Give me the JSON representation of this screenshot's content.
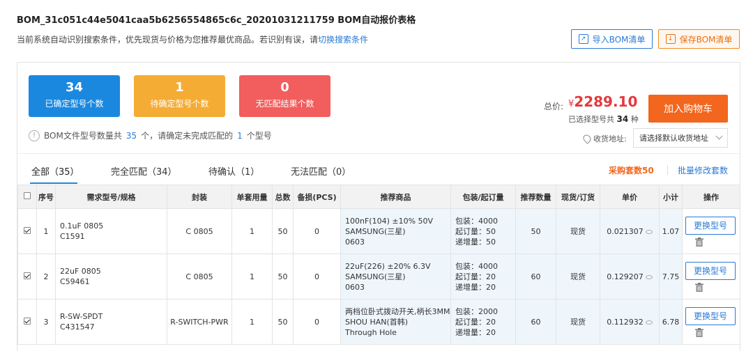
{
  "header": {
    "title": "BOM_31c051c44e5041caa5b6256554865c6c_20201031211759 BOM自动报价表格",
    "hint_text": "当前系统自动识别搜索条件，优先现货与价格为您推荐最优商品。若识别有误，请",
    "hint_link": "切换搜索条件",
    "import_button": "导入BOM清单",
    "save_button": "保存BOM清单"
  },
  "stats": [
    {
      "num": "34",
      "label": "已确定型号个数",
      "color": "#1b88df"
    },
    {
      "num": "1",
      "label": "待确定型号个数",
      "color": "#f5ac34"
    },
    {
      "num": "0",
      "label": "无匹配结果个数",
      "color": "#f25d5d"
    }
  ],
  "notice": {
    "prefix": "BOM文件型号数量共",
    "total": "35",
    "middle": "个，请确定未完成匹配的",
    "pending": "1",
    "suffix": "个型号"
  },
  "summary": {
    "total_label": "总价:",
    "currency": "¥",
    "total_value": "2289.10",
    "selected_prefix": "已选择型号共",
    "selected_count": "34",
    "selected_suffix": "种",
    "cart_button": "加入购物车",
    "address_label": "收货地址:",
    "address_placeholder": "请选择默认收货地址"
  },
  "tabs": [
    {
      "label": "全部（35）"
    },
    {
      "label": "完全匹配（34）"
    },
    {
      "label": "待确认（1）"
    },
    {
      "label": "无法匹配（0）"
    }
  ],
  "actions": {
    "purchase_sets": "采购套数50",
    "batch_edit": "批量修改套数"
  },
  "table": {
    "headers": [
      "序号",
      "需求型号/规格",
      "封装",
      "单套用量",
      "总数",
      "备损(PCS)",
      "推荐商品",
      "包装/起订量",
      "推荐数量",
      "现货/订货",
      "单价",
      "小计",
      "操作"
    ],
    "replace_label": "更换型号",
    "rows": [
      {
        "no": "1",
        "req1": "0.1uF 0805",
        "req2": "C1591",
        "package": "C 0805",
        "qty": "1",
        "total": "50",
        "loss": "0",
        "rec1": "100nF(104) ±10% 50V",
        "rec2": "SAMSUNG(三星)",
        "rec3": "0603",
        "pack1": "包装：4000",
        "pack2": "起订量：50",
        "pack3": "递增量：50",
        "rec_qty": "50",
        "stock": "现货",
        "price": "0.021307",
        "subtotal": "1.07"
      },
      {
        "no": "2",
        "req1": "22uF 0805",
        "req2": "C59461",
        "package": "C 0805",
        "qty": "1",
        "total": "50",
        "loss": "0",
        "rec1": "22uF(226) ±20% 6.3V",
        "rec2": "SAMSUNG(三星)",
        "rec3": "0603",
        "pack1": "包装：4000",
        "pack2": "起订量：20",
        "pack3": "递增量：20",
        "rec_qty": "60",
        "stock": "现货",
        "price": "0.129207",
        "subtotal": "7.75"
      },
      {
        "no": "3",
        "req1": "R-SW-SPDT",
        "req2": "C431547",
        "package": "R-SWITCH-PWR",
        "qty": "1",
        "total": "50",
        "loss": "0",
        "rec1": "两档位卧式拨动开关,柄长3MM",
        "rec2": "SHOU HAN(首韩)",
        "rec3": "Through Hole",
        "pack1": "包装：2000",
        "pack2": "起订量：20",
        "pack3": "递增量：20",
        "rec_qty": "60",
        "stock": "现货",
        "price": "0.112932",
        "subtotal": "6.78"
      }
    ]
  }
}
